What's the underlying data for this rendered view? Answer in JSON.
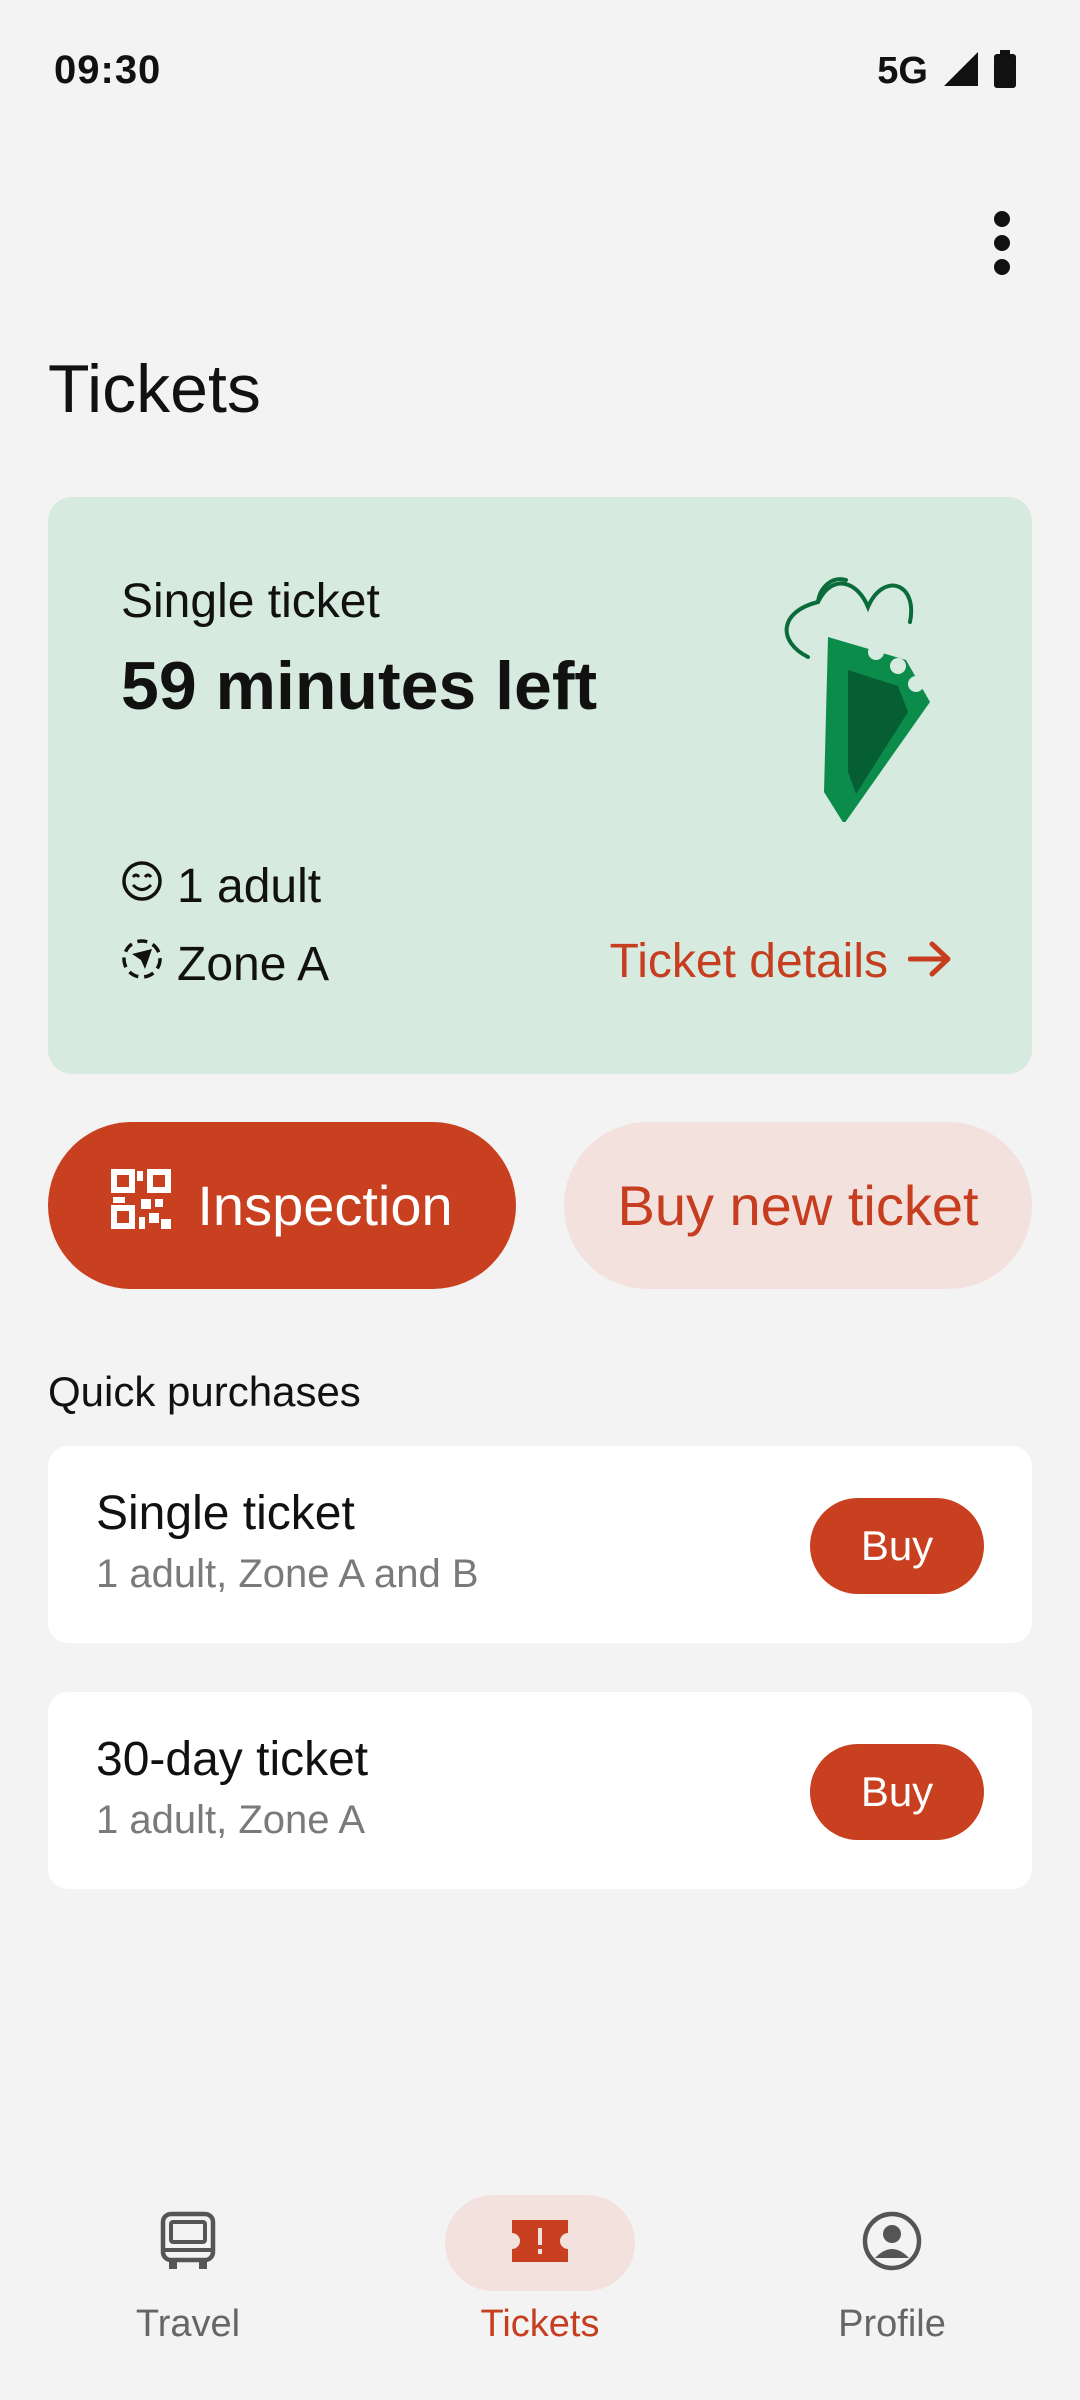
{
  "status_bar": {
    "time": "09:30",
    "network": "5G",
    "icons": [
      "signal-icon",
      "battery-icon"
    ]
  },
  "header": {
    "title": "Tickets",
    "menu_icon": "more-vert-icon"
  },
  "active_ticket": {
    "type": "Single ticket",
    "time_left": "59 minutes left",
    "passengers": "1 adult",
    "zone": "Zone A",
    "details_label": "Ticket details",
    "illustration": "ticket-illustration"
  },
  "actions": {
    "inspection_label": "Inspection",
    "buy_new_label": "Buy new ticket"
  },
  "quick_purchases": {
    "heading": "Quick purchases",
    "items": [
      {
        "title": "Single ticket",
        "subtitle": "1 adult, Zone A and B",
        "button": "Buy"
      },
      {
        "title": "30-day ticket",
        "subtitle": "1 adult, Zone A",
        "button": "Buy"
      }
    ]
  },
  "bottom_nav": {
    "items": [
      {
        "label": "Travel",
        "icon": "bus-icon",
        "active": false
      },
      {
        "label": "Tickets",
        "icon": "ticket-icon",
        "active": true
      },
      {
        "label": "Profile",
        "icon": "profile-icon",
        "active": false
      }
    ]
  },
  "colors": {
    "accent": "#c8401f",
    "card_green": "#d7eae0",
    "accent_soft": "#f3e1dd",
    "background": "#f3f3f3"
  }
}
